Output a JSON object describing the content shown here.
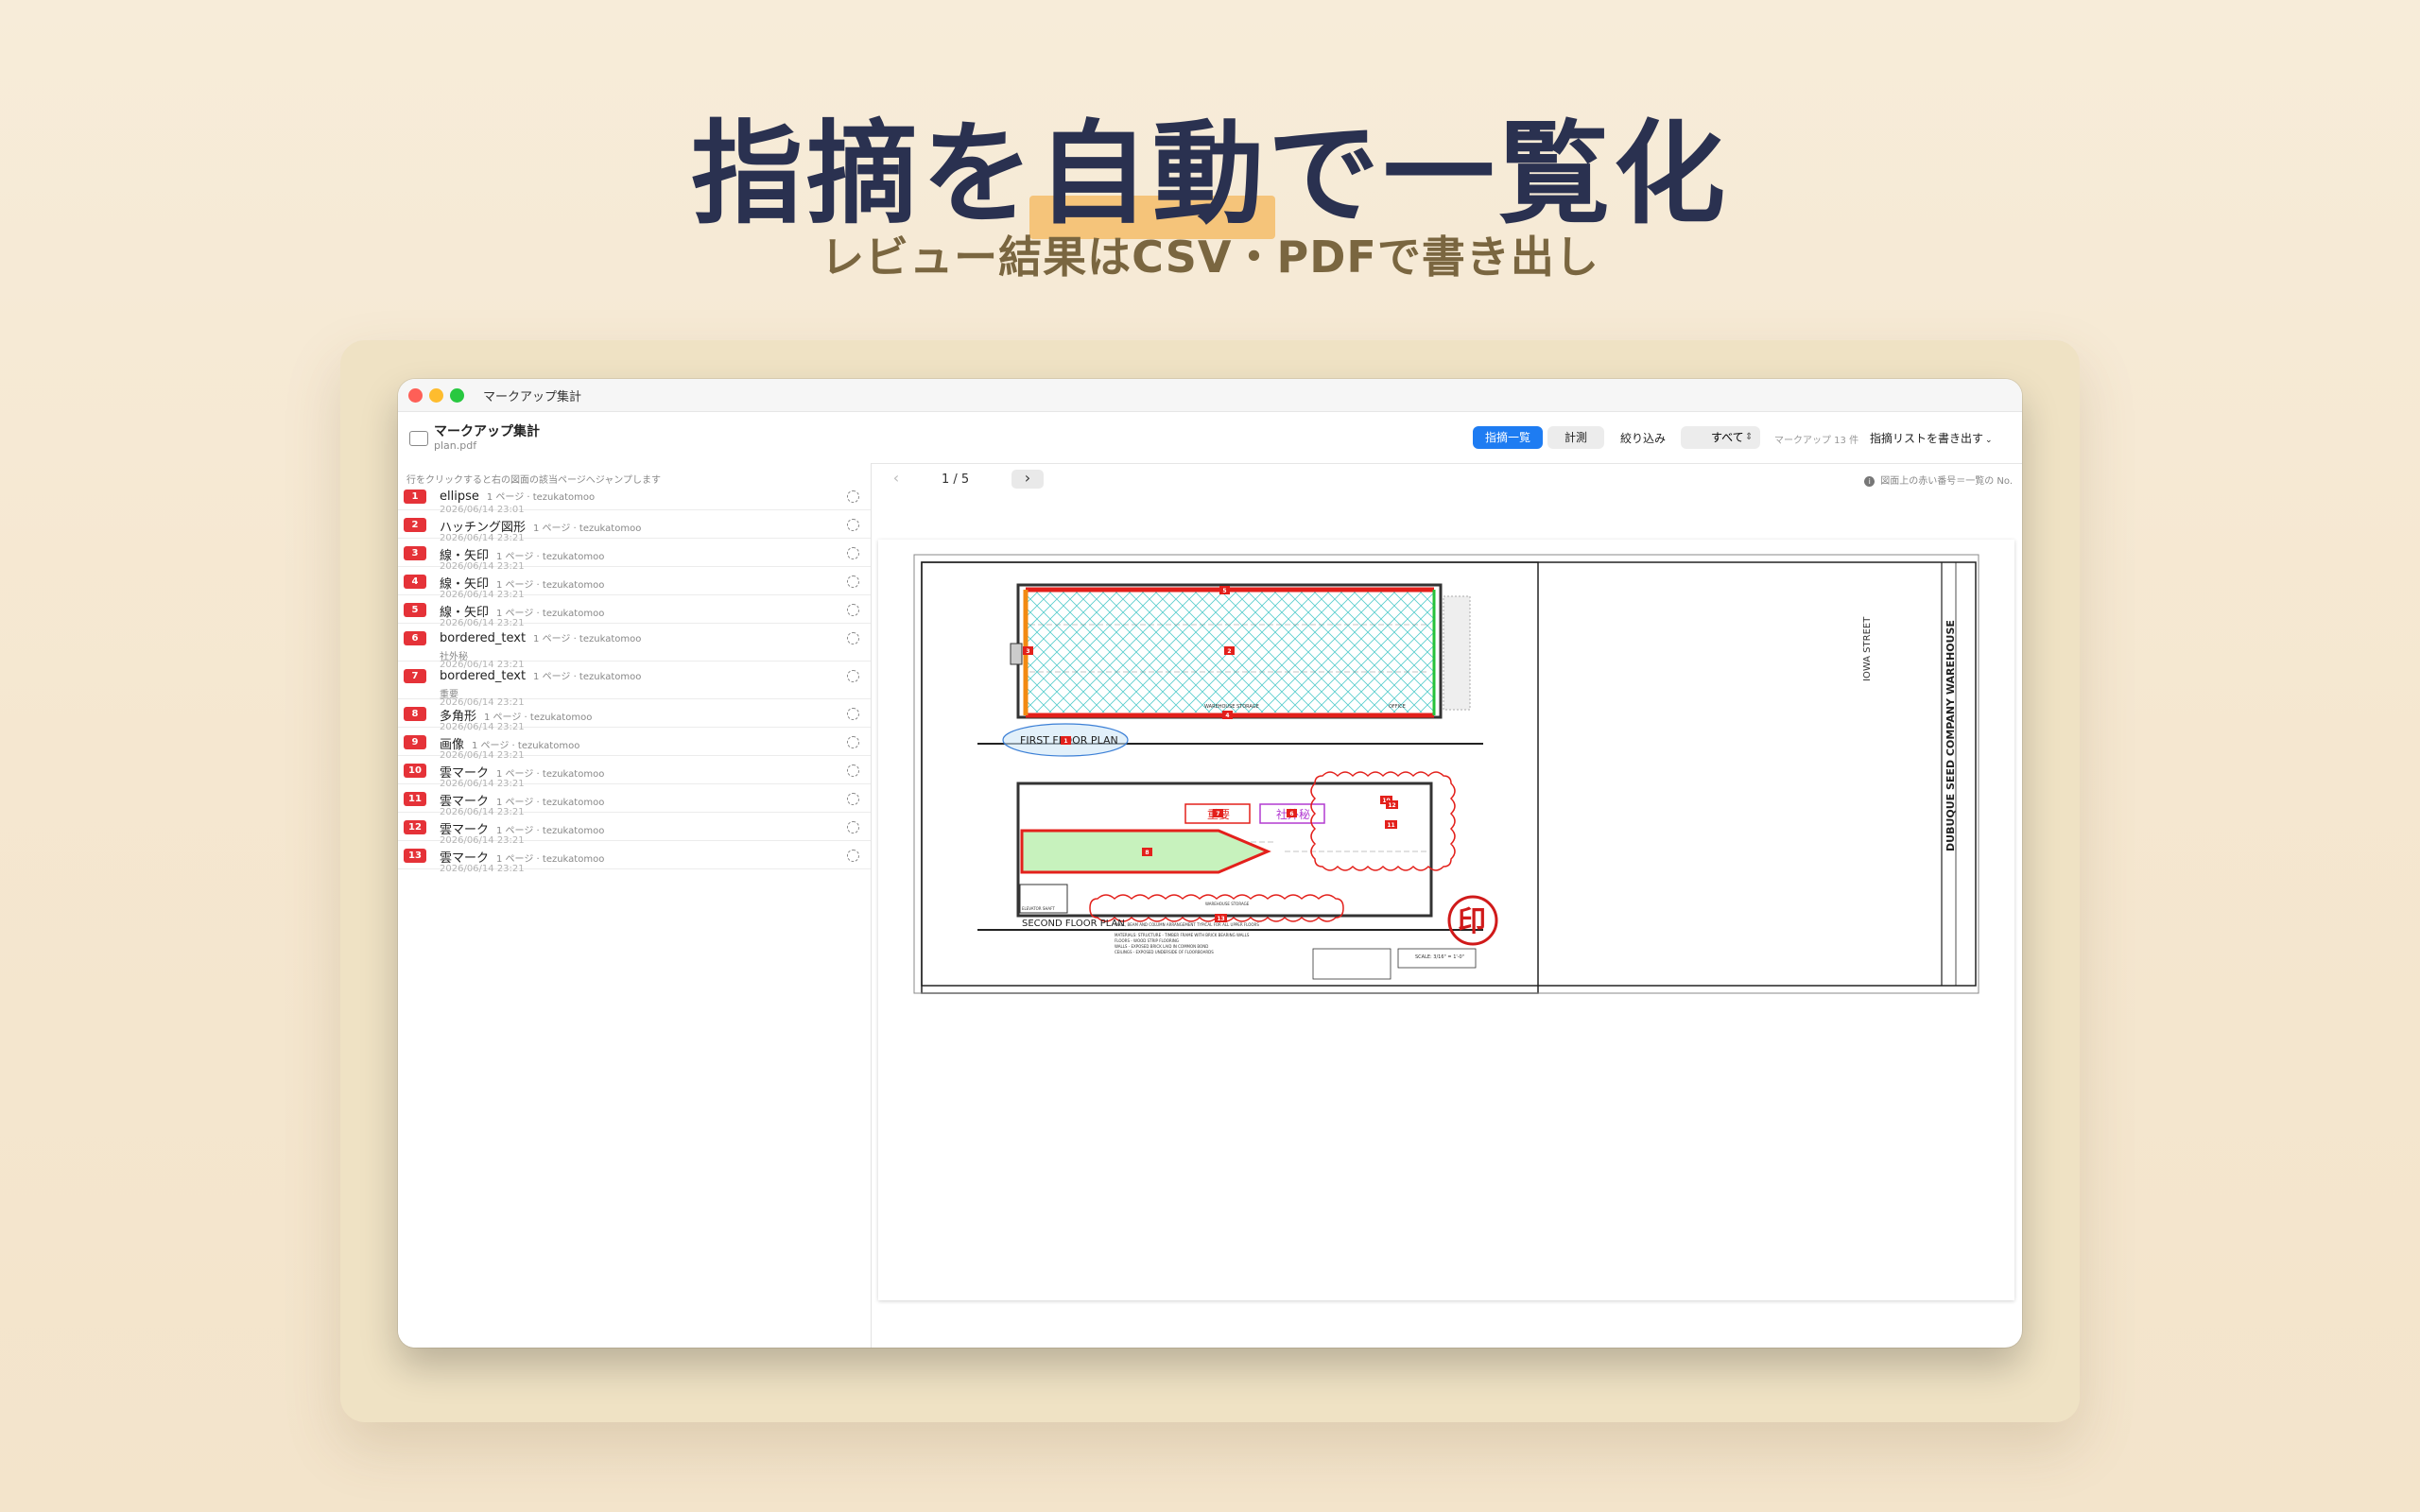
{
  "hero": {
    "title_pre": "指摘を",
    "title_hl": "自動",
    "title_post": "で一覧化",
    "subtitle": "レビュー結果はCSV・PDFで書き出し"
  },
  "window": {
    "title": "マークアップ集計",
    "doc_title": "マークアップ集計",
    "doc_file": "plan.pdf"
  },
  "toolbar": {
    "tab_list": "指摘一覧",
    "tab_measure": "計測",
    "filter_label": "絞り込み",
    "filter_value": "すべて",
    "count": "マークアップ 13 件",
    "export_label": "指摘リストを書き出す"
  },
  "sidebar": {
    "hint": "行をクリックすると右の図面の該当ページへジャンプします",
    "items": [
      {
        "no": "1",
        "name": "ellipse",
        "meta": "1 ページ · tezukatomoo",
        "sub": "",
        "date": "2026/06/14 23:01"
      },
      {
        "no": "2",
        "name": "ハッチング図形",
        "meta": "1 ページ · tezukatomoo",
        "sub": "",
        "date": "2026/06/14 23:21"
      },
      {
        "no": "3",
        "name": "線・矢印",
        "meta": "1 ページ · tezukatomoo",
        "sub": "",
        "date": "2026/06/14 23:21"
      },
      {
        "no": "4",
        "name": "線・矢印",
        "meta": "1 ページ · tezukatomoo",
        "sub": "",
        "date": "2026/06/14 23:21"
      },
      {
        "no": "5",
        "name": "線・矢印",
        "meta": "1 ページ · tezukatomoo",
        "sub": "",
        "date": "2026/06/14 23:21"
      },
      {
        "no": "6",
        "name": "bordered_text",
        "meta": "1 ページ · tezukatomoo",
        "sub": "社外秘",
        "date": "2026/06/14 23:21"
      },
      {
        "no": "7",
        "name": "bordered_text",
        "meta": "1 ページ · tezukatomoo",
        "sub": "重要",
        "date": "2026/06/14 23:21"
      },
      {
        "no": "8",
        "name": "多角形",
        "meta": "1 ページ · tezukatomoo",
        "sub": "",
        "date": "2026/06/14 23:21"
      },
      {
        "no": "9",
        "name": "画像",
        "meta": "1 ページ · tezukatomoo",
        "sub": "",
        "date": "2026/06/14 23:21"
      },
      {
        "no": "10",
        "name": "雲マーク",
        "meta": "1 ページ · tezukatomoo",
        "sub": "",
        "date": "2026/06/14 23:21"
      },
      {
        "no": "11",
        "name": "雲マーク",
        "meta": "1 ページ · tezukatomoo",
        "sub": "",
        "date": "2026/06/14 23:21"
      },
      {
        "no": "12",
        "name": "雲マーク",
        "meta": "1 ページ · tezukatomoo",
        "sub": "",
        "date": "2026/06/14 23:21"
      },
      {
        "no": "13",
        "name": "雲マーク",
        "meta": "1 ページ · tezukatomoo",
        "sub": "",
        "date": "2026/06/14 23:21"
      }
    ]
  },
  "viewer": {
    "pager_prev": "‹",
    "pager_next": "›",
    "page_text": "1 / 5",
    "info_text": "図面上の赤い番号＝一覧の No."
  },
  "drawing": {
    "first_floor_label": "FIRST FLOOR PLAN",
    "second_floor_label": "SECOND FLOOR PLAN",
    "second_floor_note": "WALL, BEAM AND COLUMN ARRANGEMENT TYPICAL FOR ALL UPPER FLOORS",
    "street_label": "IOWA STREET",
    "title_block": "DUBUQUE SEED COMPANY WAREHOUSE",
    "scale_text": "SCALE: 3/16\" = 1'-0\"",
    "stamp_text": "印",
    "text_important": "重要",
    "text_confidential": "社外秘",
    "warehouse_storage": "WAREHOUSE STORAGE",
    "elevator_shaft": "ELEVATOR SHAFT",
    "office": "OFFICE",
    "materials_lines": [
      "MATERIALS:  STRUCTURE - TIMBER FRAME WITH BRICK BEARING WALLS",
      "FLOORS - WOOD STRIP FLOORING",
      "WALLS - EXPOSED BRICK LAID IN COMMON BOND",
      "CEILINGS - EXPOSED UNDERSIDE OF FLOORBOARDS"
    ],
    "marker_1": "1",
    "marker_2": "2",
    "marker_3": "3",
    "marker_4": "4",
    "marker_5": "5",
    "marker_6": "6",
    "marker_7": "7",
    "marker_8": "8",
    "marker_9": "9",
    "marker_10": "10",
    "marker_11": "11",
    "marker_12": "12",
    "marker_13": "13"
  },
  "colors": {
    "accent_blue": "#1e7cf2",
    "badge_red": "#e53238",
    "markup_red": "#e3201b",
    "markup_orange": "#f28a12",
    "markup_green": "#27c23a",
    "hatch_cyan": "#5ad0d0",
    "polygon_fill": "#c7f2bd",
    "highlight": "#f5c47a"
  }
}
